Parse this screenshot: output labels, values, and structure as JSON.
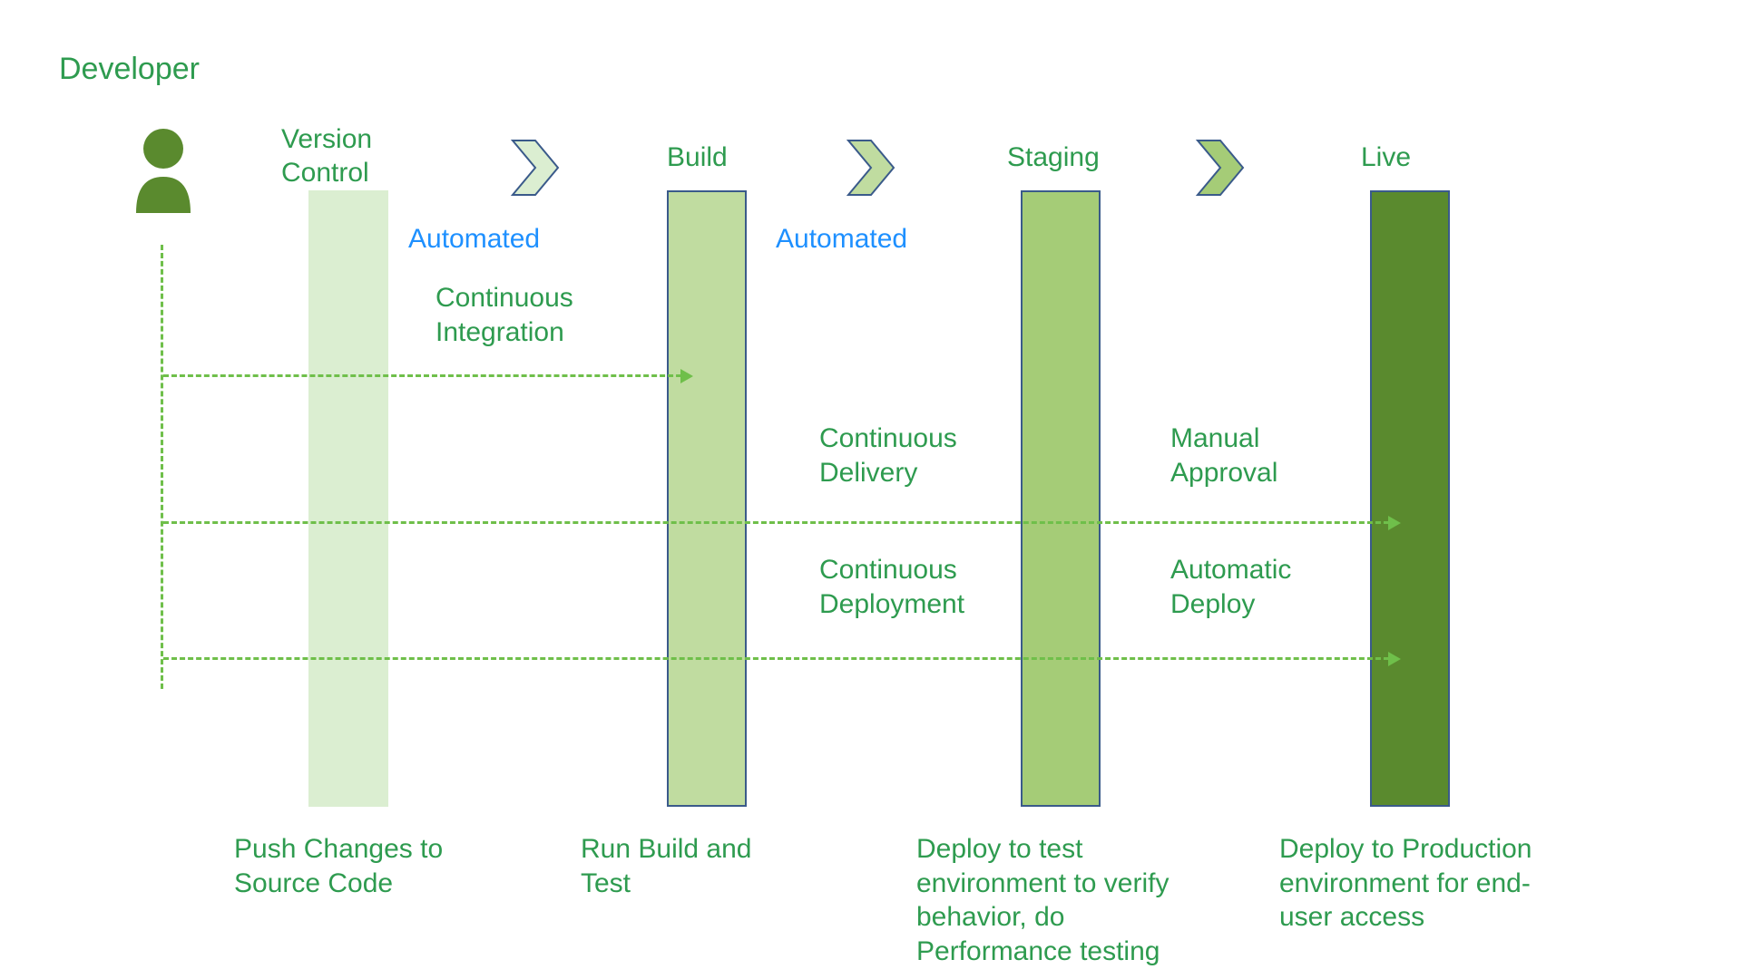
{
  "developer_label": "Developer",
  "stages": {
    "version_control": {
      "title_line1": "Version",
      "title_line2": "Control",
      "desc": "Push Changes to Source Code"
    },
    "build": {
      "title": "Build",
      "desc": "Run Build and Test"
    },
    "staging": {
      "title": "Staging",
      "desc": "Deploy to test environment to verify behavior, do Performance testing"
    },
    "live": {
      "title": "Live",
      "desc": "Deploy to Production environment for end-user access"
    }
  },
  "labels": {
    "automated1": "Automated",
    "automated2": "Automated",
    "ci_line1": "Continuous",
    "ci_line2": "Integration",
    "cdel_line1": "Continuous",
    "cdel_line2": "Delivery",
    "cdep_line1": "Continuous",
    "cdep_line2": "Deployment",
    "manual_line1": "Manual",
    "manual_line2": "Approval",
    "auto_line1": "Automatic",
    "auto_line2": "Deploy"
  }
}
